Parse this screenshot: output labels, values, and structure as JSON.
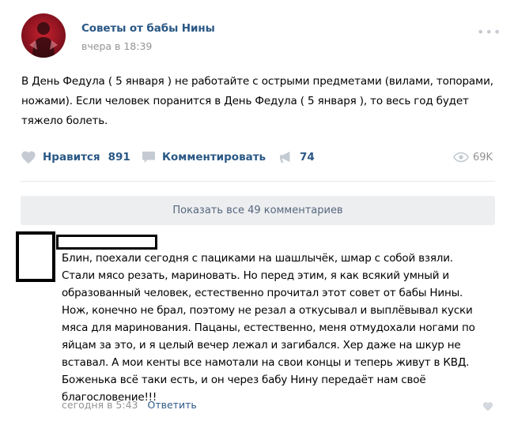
{
  "post": {
    "group_name": "Советы от бабы Нины",
    "time": "вчера в 18:39",
    "text": "В День Федула ( 5 января ) не работайте с острыми предметами (вилами, топорами, ножами). Если человек поранится в День Федула ( 5 января ), то весь год будет тяжело болеть."
  },
  "actions": {
    "like_label": "Нравится",
    "like_count": "891",
    "comment_label": "Комментировать",
    "share_count": "74",
    "views": "69K"
  },
  "comments": {
    "show_all_label": "Показать все 49 комментариев"
  },
  "comment": {
    "text": "Блин, поехали сегодня с пациками на шашлычёк, шмар с собой взяли. Стали мясо резать, мариновать. Но перед этим, я как всякий умный и образованный человек, естественно прочитал этот совет от бабы Нины. Нож, конечно не брал, поэтому не резал а откусывал и выплёвывал куски мяса для маринования. Пацаны, естественно, меня отмудохали ногами по яйцам за это, и я целый вечер лежал и загибался. Хер даже на шкур не вставал. А мои кенты все намотали на свои концы и теперь живут в КВД. Боженька всё таки есть, и он через бабу Нину передаёт нам своё благословение!!!",
    "time": "сегодня в 5:43",
    "reply_label": "Ответить"
  },
  "colors": {
    "link": "#2a5885",
    "muted": "#939393",
    "icon": "#c5cbd2",
    "panel": "#edeef0"
  }
}
